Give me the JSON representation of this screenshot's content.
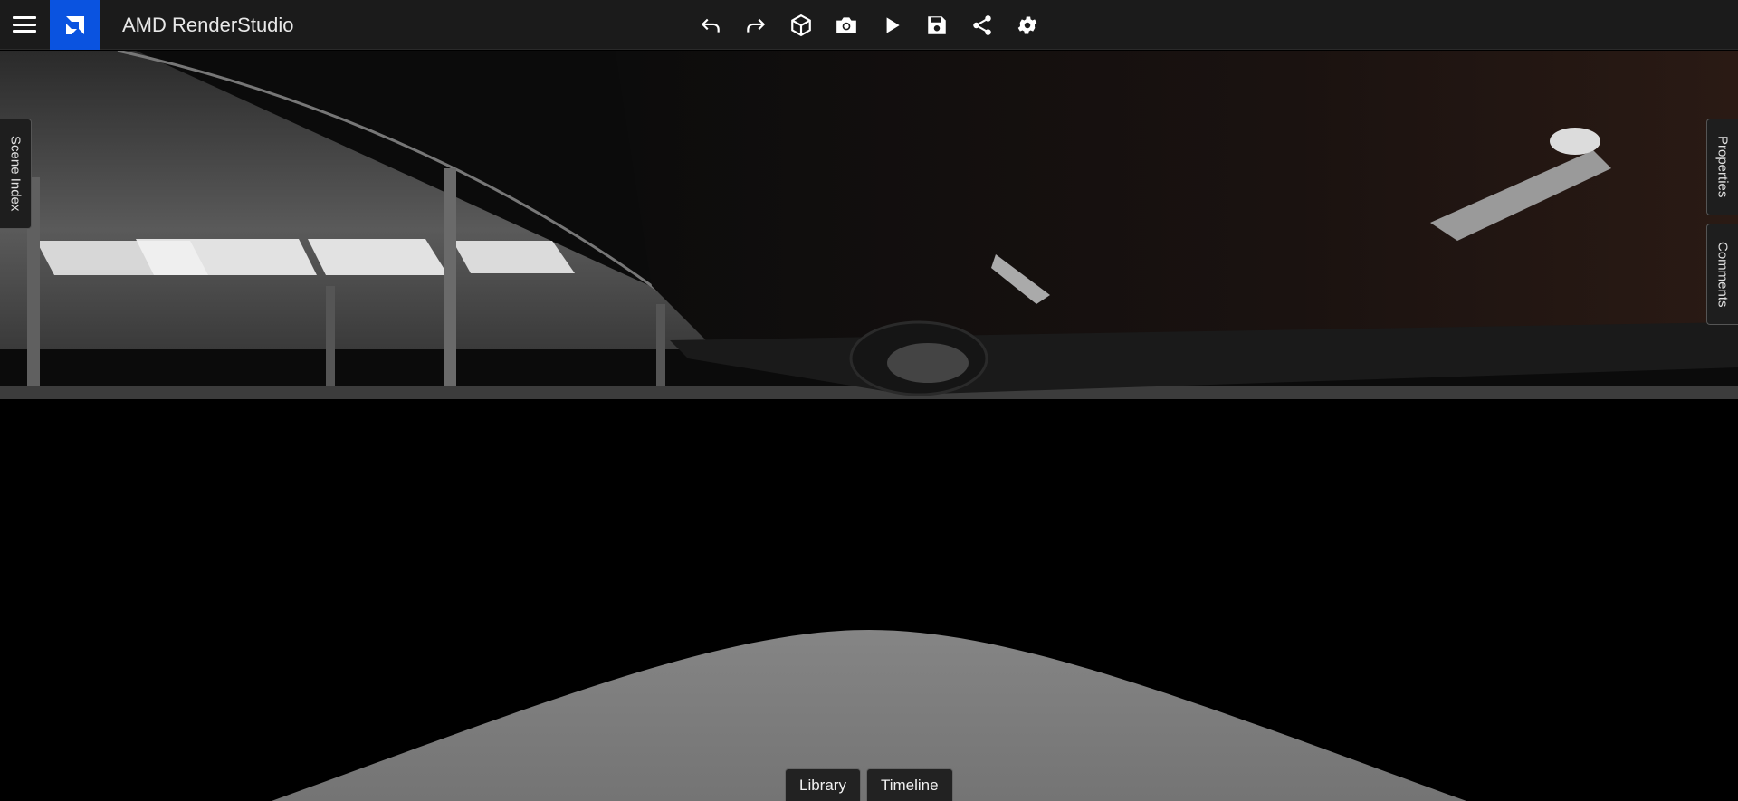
{
  "app": {
    "title": "AMD RenderStudio"
  },
  "toolbar": {
    "items": [
      {
        "name": "undo-icon",
        "label": "Undo"
      },
      {
        "name": "redo-icon",
        "label": "Redo"
      },
      {
        "name": "cube-icon",
        "label": "3D View"
      },
      {
        "name": "camera-icon",
        "label": "Screenshot"
      },
      {
        "name": "play-icon",
        "label": "Play"
      },
      {
        "name": "save-icon",
        "label": "Save"
      },
      {
        "name": "share-icon",
        "label": "Share"
      },
      {
        "name": "gear-icon",
        "label": "Settings"
      }
    ]
  },
  "side_tabs": {
    "left": "Scene Index",
    "right_top": "Properties",
    "right_bottom": "Comments"
  },
  "bottom_tabs": {
    "library": "Library",
    "timeline": "Timeline"
  },
  "colors": {
    "accent": "#0a53e0",
    "bar": "#1b1b1b"
  }
}
